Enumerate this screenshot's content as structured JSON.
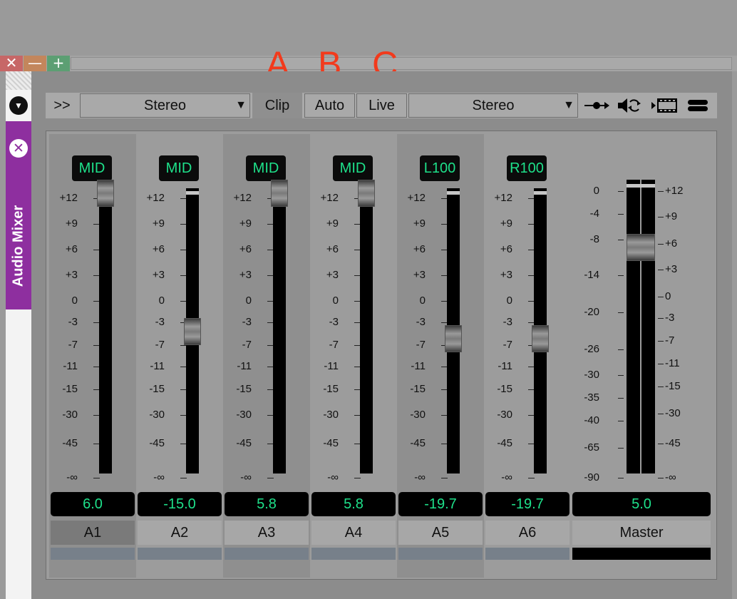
{
  "window": {
    "close_glyph": "✕",
    "minimize_glyph": "—",
    "maximize_glyph": "+"
  },
  "callouts": [
    "A",
    "B",
    "C"
  ],
  "sidebar": {
    "collapse_glyph": "▼",
    "tab_label": "Audio Mixer",
    "tab_close_glyph": "✕",
    "tab_color": "#8e2f9f"
  },
  "toolbar": {
    "expand_label": ">>",
    "clip_input_mode": "Stereo",
    "clip_label": "Clip",
    "auto_label": "Auto",
    "live_label": "Live",
    "output_mode": "Stereo",
    "dropdown_caret": "▼",
    "icons": [
      "routing-icon",
      "audio-sync-icon",
      "film-audio-icon",
      "menu-icon"
    ]
  },
  "channel_scale": [
    "+12",
    "+9",
    "+6",
    "+3",
    "0",
    "-3",
    "-7",
    "-11",
    "-15",
    "-30",
    "-45",
    "-∞"
  ],
  "channels": [
    {
      "pan": "MID",
      "value": "6.0",
      "name": "A1",
      "selected": true
    },
    {
      "pan": "MID",
      "value": "-15.0",
      "name": "A2",
      "selected": false
    },
    {
      "pan": "MID",
      "value": "5.8",
      "name": "A3",
      "selected": false
    },
    {
      "pan": "MID",
      "value": "5.8",
      "name": "A4",
      "selected": false
    },
    {
      "pan": "L100",
      "value": "-19.7",
      "name": "A5",
      "selected": false
    },
    {
      "pan": "R100",
      "value": "-19.7",
      "name": "A6",
      "selected": false
    }
  ],
  "master": {
    "meter_scale": [
      "0",
      "-4",
      "-8",
      "-14",
      "-20",
      "-26",
      "-30",
      "-35",
      "-40",
      "-65",
      "-90"
    ],
    "fader_scale": [
      "+12",
      "+9",
      "+6",
      "+3",
      "0",
      "-3",
      "-7",
      "-11",
      "-15",
      "-30",
      "-45",
      "-∞"
    ],
    "value": "5.0",
    "name": "Master"
  },
  "colors": {
    "readout_text": "#1ee08a",
    "channel_color_bar": "#77808a",
    "callout": "#f23a1c"
  }
}
